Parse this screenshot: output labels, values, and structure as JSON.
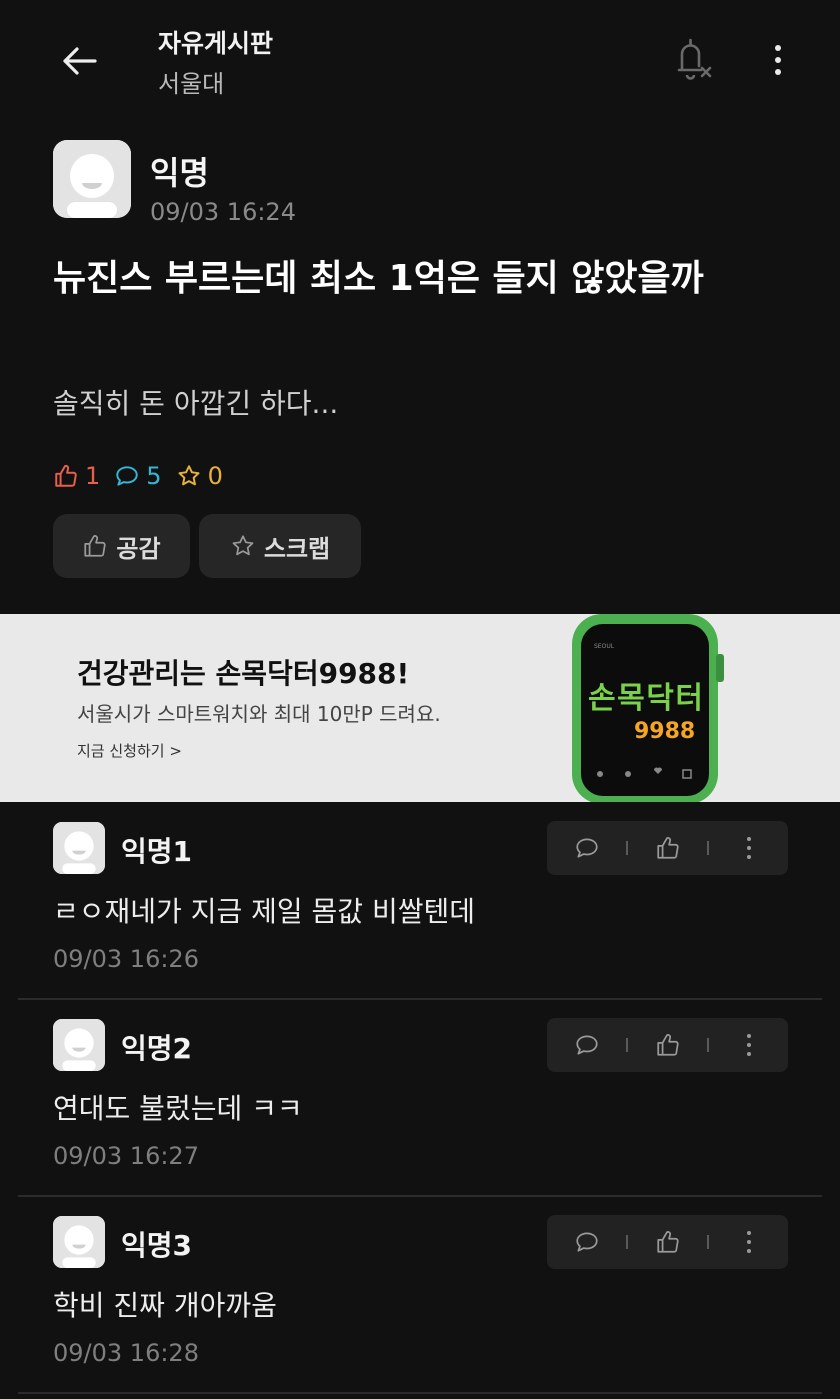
{
  "header": {
    "title": "자유게시판",
    "subtitle": "서울대",
    "icons": {
      "back": "arrow-left-icon",
      "bell": "bell-off-icon",
      "more": "more-vertical-icon"
    }
  },
  "post": {
    "author": "익명",
    "time": "09/03 16:24",
    "title": "뉴진스 부르는데 최소 1억은 들지 않았을까",
    "body": "솔직히 돈 아깝긴 하다...",
    "stats": {
      "likes": "1",
      "comments": "5",
      "scraps": "0"
    },
    "buttons": {
      "like": "공감",
      "scrap": "스크랩"
    },
    "colors": {
      "like": "#e8604c",
      "comment": "#35b6d6",
      "scrap": "#e8b23a"
    }
  },
  "ad": {
    "title": "건강관리는 손목닥터9988!",
    "description": "서울시가 스마트워치와 최대 10만P 드려요.",
    "link": "지금 신청하기 >",
    "watch_text_top": "손목닥터",
    "watch_text_bottom": "9988",
    "watch_brand": "SEOUL"
  },
  "comments": [
    {
      "author": "익명1",
      "body": "ㄹㅇ재네가 지금 제일 몸값 비쌀텐데",
      "time": "09/03 16:26"
    },
    {
      "author": "익명2",
      "body": "연대도 불렀는데 ㅋㅋ",
      "time": "09/03 16:27"
    },
    {
      "author": "익명3",
      "body": "학비 진짜 개아까움",
      "time": "09/03 16:28"
    }
  ]
}
